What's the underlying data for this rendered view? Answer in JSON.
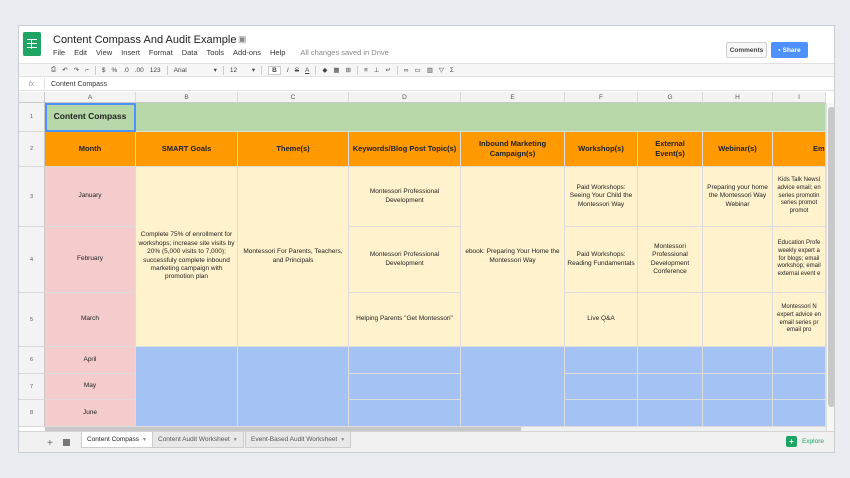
{
  "app": {
    "title": "Content Compass And Audit Example",
    "saved_status": "All changes saved in Drive",
    "menu": [
      "File",
      "Edit",
      "View",
      "Insert",
      "Format",
      "Data",
      "Tools",
      "Add-ons",
      "Help"
    ],
    "comments_label": "Comments",
    "share_label": "Share"
  },
  "toolbar": {
    "currency": "$",
    "percent": "%",
    "decimal_less": ".0",
    "decimal_more": ".00",
    "number_format": "123",
    "font": "Arial",
    "font_size": "12",
    "bold": "B",
    "italic": "I",
    "strike": "S",
    "text_color": "A",
    "sigma": "Σ"
  },
  "formula_bar": {
    "fx": "fx",
    "value": "Content Compass"
  },
  "grid": {
    "columns": [
      "A",
      "B",
      "C",
      "D",
      "E",
      "F",
      "G",
      "H",
      "I"
    ],
    "rows": [
      "1",
      "2",
      "3",
      "4",
      "5",
      "6",
      "7",
      "8"
    ],
    "title_cell": "Content Compass",
    "headers": [
      "Month",
      "SMART Goals",
      "Theme(s)",
      "Keywords/Blog Post Topic(s)",
      "Inbound Marketing Campaign(s)",
      "Workshop(s)",
      "External Event(s)",
      "Webinar(s)",
      "Em"
    ],
    "months": [
      "January",
      "February",
      "March",
      "April",
      "May",
      "June"
    ],
    "smart_goals": "Complete 75% of enrollment for workshops; increase site visits by 20% (5,000 visits to 7,000); successfuly complete inbound marketing campaign with promotion plan",
    "themes": "Montessori For Parents, Teachers, and Principals",
    "keywords": [
      "Montessori Professional Development",
      "Montessori Professional Development",
      "Helping Parents \"Get Montessori\""
    ],
    "campaign": "ebook: Preparing Your Home the Montessori Way",
    "workshops": [
      "Paid Workshops: Seeing Your Child the Montessori Way",
      "Paid Workshops: Reading Fundamentals",
      "Live Q&A"
    ],
    "external_event": "Montessori Professional Development Conference",
    "webinar": "Preparing your home the Montessori Way Webinar",
    "email": [
      "Kids Talk Newsl advice email; en series promotin series promot promot",
      "Education Profe weekly expert a for blogs; email workshop; email external event e",
      "Montessori N expert advice en email series pr email pro"
    ]
  },
  "tabs": [
    "Content Compass",
    "Content Audit Worksheet",
    "Event-Based Audit Worksheet"
  ],
  "explore_label": "Explore",
  "colors": {
    "header_orange": "#ff9900",
    "title_green": "#b6d7a8",
    "month_pink": "#f4cccc",
    "content_yellow": "#fff2cc",
    "future_blue": "#a4c2f4",
    "share_blue": "#4d90fe",
    "sheets_green": "#1fa463"
  }
}
